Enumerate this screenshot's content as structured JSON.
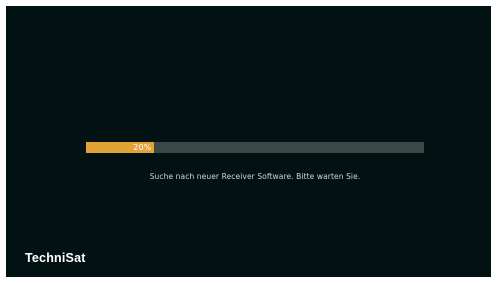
{
  "progress": {
    "value_percent": 20,
    "label": "20%"
  },
  "status": {
    "message": "Suche nach neuer Receiver Software. Bitte warten Sie."
  },
  "brand": {
    "name": "TechniSat"
  },
  "colors": {
    "background": "#021112",
    "progress_fill": "#e1a333",
    "progress_track": "#3a4847",
    "text": "#cfd6d6"
  }
}
